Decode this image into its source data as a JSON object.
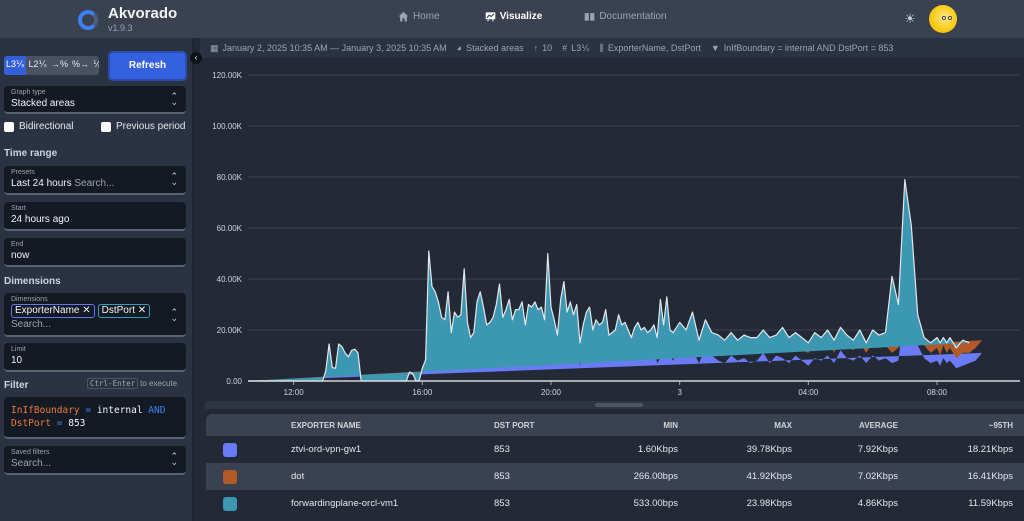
{
  "app": {
    "name": "Akvorado",
    "version": "v1.9.3"
  },
  "nav": {
    "items": [
      {
        "label": "Home",
        "icon": "home-icon",
        "active": false
      },
      {
        "label": "Visualize",
        "icon": "chart-icon",
        "active": true
      },
      {
        "label": "Documentation",
        "icon": "book-icon",
        "active": false
      }
    ]
  },
  "header": {
    "theme_icon": "sun-icon",
    "avatar": "avatar"
  },
  "sidebar": {
    "units": [
      {
        "label": "L3⅟ₛ",
        "selected": true
      },
      {
        "label": "L2⅟ₛ",
        "selected": false
      },
      {
        "label": "→%",
        "selected": false
      },
      {
        "label": "%→",
        "selected": false
      },
      {
        "label": "⅟ₚ",
        "selected": false
      }
    ],
    "refresh_label": "Refresh",
    "graph_type": {
      "label": "Graph type",
      "value": "Stacked areas"
    },
    "bidirectional_label": "Bidirectional",
    "previous_period_label": "Previous period",
    "time_range_heading": "Time range",
    "presets": {
      "label": "Presets",
      "value": "Last 24 hours",
      "placeholder": "Search..."
    },
    "start": {
      "label": "Start",
      "value": "24 hours ago"
    },
    "end": {
      "label": "End",
      "value": "now"
    },
    "dimensions_heading": "Dimensions",
    "dimensions": {
      "label": "Dimensions",
      "tags": [
        "ExporterName",
        "DstPort"
      ],
      "placeholder": "Search..."
    },
    "limit": {
      "label": "Limit",
      "value": "10"
    },
    "filter_heading": "Filter",
    "filter_hint_key": "Ctrl-Enter",
    "filter_hint_text": "to execute",
    "filter_tokens": [
      {
        "t": "InIfBoundary",
        "c": "orange"
      },
      {
        "t": " = ",
        "c": "blue"
      },
      {
        "t": "internal ",
        "c": "white"
      },
      {
        "t": "AND",
        "c": "blue"
      },
      {
        "t": "\n",
        "c": "br"
      },
      {
        "t": "DstPort",
        "c": "orange"
      },
      {
        "t": " = ",
        "c": "blue"
      },
      {
        "t": "853",
        "c": "white"
      }
    ],
    "saved_filters": {
      "label": "Saved filters",
      "placeholder": "Search..."
    }
  },
  "info_bar": {
    "time_range": "January 2, 2025 10:35 AM — January 3, 2025 10:35 AM",
    "graph_type": "Stacked areas",
    "limit": "10",
    "unit": "L3⅟ₛ",
    "dimensions": "ExporterName, DstPort",
    "filter": "InIfBoundary = internal AND DstPort = 853"
  },
  "table": {
    "columns": [
      "",
      "EXPORTER NAME",
      "DST PORT",
      "MIN",
      "MAX",
      "AVERAGE",
      "~95TH"
    ],
    "rows": [
      {
        "color": "#6b7bf7",
        "exporter": "ztvi-ord-vpn-gw1",
        "port": "853",
        "min": "1.60Kbps",
        "max": "39.78Kbps",
        "avg": "7.92Kbps",
        "p95": "18.21Kbps"
      },
      {
        "color": "#b25a27",
        "exporter": "dot",
        "port": "853",
        "min": "266.00bps",
        "max": "41.92Kbps",
        "avg": "7.02Kbps",
        "p95": "16.41Kbps"
      },
      {
        "color": "#3c97b3",
        "exporter": "forwardingplane-orcl-vm1",
        "port": "853",
        "min": "533.00bps",
        "max": "23.98Kbps",
        "avg": "4.86Kbps",
        "p95": "11.59Kbps"
      }
    ]
  },
  "chart_data": {
    "type": "area",
    "stacked": true,
    "title": "",
    "xlabel": "",
    "ylabel": "",
    "ylim": [
      0,
      120000
    ],
    "yticks": [
      0,
      20000,
      40000,
      60000,
      80000,
      100000,
      120000
    ],
    "ytick_labels": [
      "0.00",
      "20.00K",
      "40.00K",
      "60.00K",
      "80.00K",
      "100.00K",
      "120.00K"
    ],
    "xlim_hours": [
      10.58,
      34.58
    ],
    "xticks_hours": [
      12,
      16,
      20,
      24,
      28,
      32
    ],
    "xtick_labels": [
      "12:00",
      "16:00",
      "20:00",
      "3",
      "04:00",
      "08:00"
    ],
    "grid": true,
    "legend": "table-below",
    "x_hours": [
      10.58,
      11.0,
      11.5,
      12.0,
      12.5,
      12.9,
      13.0,
      13.1,
      13.2,
      13.3,
      13.4,
      13.5,
      13.6,
      13.7,
      13.8,
      13.9,
      14.0,
      14.1,
      14.2,
      14.3,
      14.4,
      15.0,
      15.5,
      15.6,
      15.7,
      15.8,
      15.9,
      16.0,
      16.1,
      16.2,
      16.3,
      16.4,
      16.5,
      16.6,
      16.7,
      16.8,
      16.9,
      17.0,
      17.1,
      17.2,
      17.3,
      17.4,
      17.5,
      17.6,
      17.7,
      17.8,
      17.9,
      18.0,
      18.1,
      18.2,
      18.3,
      18.4,
      18.5,
      18.6,
      18.7,
      18.8,
      18.9,
      19.0,
      19.1,
      19.2,
      19.3,
      19.4,
      19.5,
      19.6,
      19.7,
      19.8,
      19.9,
      20.0,
      20.1,
      20.2,
      20.3,
      20.4,
      20.5,
      20.6,
      20.7,
      20.8,
      20.9,
      21.0,
      21.1,
      21.2,
      21.3,
      21.4,
      21.5,
      21.6,
      21.7,
      21.8,
      21.9,
      22.0,
      22.1,
      22.2,
      22.3,
      22.4,
      22.5,
      22.6,
      22.7,
      22.8,
      22.9,
      23.0,
      23.1,
      23.2,
      23.3,
      23.4,
      23.5,
      23.6,
      23.7,
      23.8,
      23.9,
      24.0,
      24.2,
      24.4,
      24.6,
      24.8,
      25.0,
      25.2,
      25.4,
      25.6,
      25.8,
      26.0,
      26.2,
      26.4,
      26.6,
      26.8,
      27.0,
      27.2,
      27.4,
      27.6,
      27.8,
      28.0,
      28.2,
      28.4,
      28.6,
      28.8,
      29.0,
      29.2,
      29.4,
      29.6,
      29.8,
      30.0,
      30.2,
      30.4,
      30.6,
      30.8,
      31.0,
      31.2,
      31.4,
      31.6,
      31.8,
      32.0,
      32.1,
      32.2,
      32.3,
      32.4,
      32.6,
      32.8,
      33.0,
      33.2,
      33.4,
      33.6,
      33.8,
      34.0,
      34.2,
      34.4,
      34.58
    ],
    "series": [
      {
        "name": "ztvi-ord-vpn-gw1 / 853",
        "color": "#6b7bf7",
        "values": [
          0,
          0,
          0,
          0,
          0,
          0,
          3000,
          4500,
          3000,
          3000,
          2500,
          3500,
          5000,
          6000,
          7500,
          6500,
          4500,
          0,
          0,
          0,
          0,
          0,
          0,
          3500,
          3000,
          0,
          0,
          4000,
          6000,
          31000,
          22000,
          17000,
          14000,
          12000,
          9000,
          17000,
          8000,
          10000,
          14000,
          12000,
          20000,
          9000,
          6000,
          8000,
          15000,
          17000,
          13000,
          12000,
          9000,
          8000,
          11000,
          18000,
          11000,
          13000,
          16000,
          10000,
          14000,
          13000,
          12000,
          7000,
          13000,
          12000,
          15000,
          14000,
          13000,
          9000,
          20000,
          12000,
          10000,
          7000,
          14000,
          18000,
          12000,
          13000,
          10000,
          15000,
          6000,
          11000,
          14000,
          18000,
          9000,
          13000,
          11000,
          10000,
          16000,
          8000,
          9000,
          10000,
          14000,
          10000,
          12000,
          9000,
          8000,
          11000,
          13000,
          10000,
          11000,
          9000,
          10000,
          12000,
          7000,
          9000,
          11000,
          14000,
          10000,
          8000,
          11000,
          9000,
          10000,
          12000,
          7000,
          13000,
          10000,
          8000,
          7000,
          10000,
          8000,
          9000,
          7000,
          8000,
          11000,
          7000,
          10000,
          9000,
          7000,
          10000,
          8000,
          6000,
          9000,
          8000,
          10000,
          7000,
          12000,
          9000,
          8000,
          10000,
          7000,
          10000,
          8000,
          9000,
          7000,
          8000,
          30000,
          22000,
          14000,
          9000,
          7000,
          8000,
          6000,
          9000,
          7000,
          8000,
          5000,
          6000,
          7000,
          8000,
          11000
        ]
      },
      {
        "name": "dot / 853",
        "color": "#b25a27",
        "values": [
          0,
          0,
          0,
          0,
          0,
          0,
          1000,
          9500,
          2000,
          1500,
          8500,
          5500,
          4000,
          2500,
          3000,
          4500,
          5000,
          0,
          0,
          0,
          0,
          0,
          0,
          0,
          0,
          0,
          0,
          1000,
          2000,
          14000,
          9000,
          7000,
          7000,
          6000,
          7000,
          8000,
          6000,
          9000,
          6000,
          8000,
          14000,
          7000,
          5000,
          5000,
          10000,
          12000,
          9000,
          5000,
          6000,
          8000,
          8000,
          10000,
          7000,
          7000,
          8000,
          8000,
          7000,
          9000,
          10000,
          8000,
          9000,
          8000,
          9000,
          8000,
          9000,
          9000,
          15000,
          9000,
          7000,
          5000,
          10000,
          11000,
          8000,
          9000,
          8000,
          9000,
          5000,
          6000,
          7000,
          6000,
          6000,
          6000,
          6000,
          7000,
          7000,
          5000,
          6000,
          5000,
          6000,
          6000,
          7000,
          6000,
          4000,
          6000,
          5000,
          6000,
          5000,
          5000,
          6000,
          5000,
          4000,
          5000,
          6000,
          15000,
          5000,
          5000,
          6000,
          5000,
          5000,
          11000,
          5000,
          6000,
          5000,
          5000,
          4000,
          5000,
          5000,
          5000,
          4000,
          4000,
          6000,
          5000,
          4000,
          6000,
          5000,
          5000,
          4000,
          5000,
          5000,
          5000,
          6000,
          4000,
          6000,
          5000,
          4000,
          5000,
          4000,
          5000,
          5000,
          5000,
          4000,
          5000,
          45000,
          35000,
          8000,
          5000,
          4000,
          5000,
          4000,
          5000,
          4000,
          5000,
          4000,
          5000,
          4000,
          5000,
          5000
        ]
      },
      {
        "name": "forwardingplane-orcl-vm1 / 853",
        "color": "#3c97b3",
        "values": [
          0,
          0,
          0,
          0,
          0,
          0,
          0,
          500,
          300,
          500,
          3500,
          4500,
          2000,
          1000,
          1500,
          1500,
          1500,
          0,
          0,
          0,
          0,
          0,
          0,
          0,
          0,
          0,
          0,
          0,
          300,
          6000,
          6000,
          11000,
          10000,
          7000,
          8000,
          10000,
          5000,
          8000,
          5000,
          6000,
          10000,
          7000,
          6000,
          6000,
          6000,
          6000,
          7000,
          5000,
          8000,
          9000,
          11000,
          10000,
          7000,
          8000,
          8000,
          6000,
          7000,
          6000,
          9000,
          7000,
          8000,
          9000,
          7000,
          6000,
          7000,
          6000,
          15000,
          8000,
          7000,
          6000,
          8000,
          10000,
          7000,
          9000,
          8000,
          6000,
          4000,
          5000,
          6000,
          5000,
          5000,
          5000,
          5000,
          6000,
          5000,
          5000,
          4000,
          5000,
          6000,
          6000,
          4000,
          5000,
          5000,
          4000,
          5000,
          4000,
          5000,
          5000,
          4000,
          5000,
          6000,
          18000,
          5000,
          4000,
          5000,
          6000,
          4000,
          9000,
          5000,
          4000,
          4000,
          5000,
          4000,
          5000,
          5000,
          4000,
          3000,
          4000,
          6000,
          5000,
          3000,
          5000,
          4000,
          6000,
          5000,
          4000,
          5000,
          4000,
          5000,
          4000,
          4000,
          5000,
          3000,
          4000,
          4000,
          5000,
          4000,
          5000,
          5000,
          5000,
          30000,
          17000,
          4000,
          4000,
          4000,
          3000,
          4000,
          4000,
          5000,
          3000,
          4000,
          4000,
          4000,
          5000,
          4000
        ]
      }
    ]
  }
}
